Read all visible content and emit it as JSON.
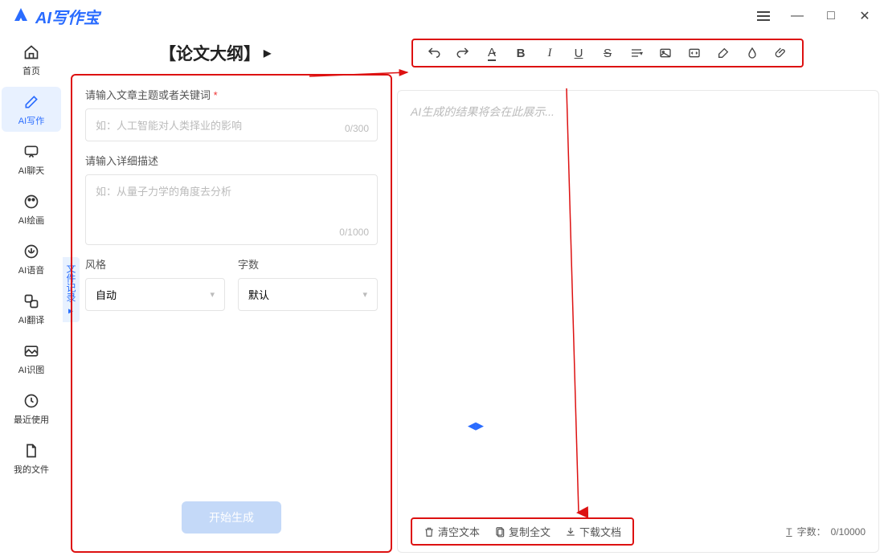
{
  "app": {
    "name": "AI写作宝"
  },
  "window": {
    "menu": "≡",
    "min": "—",
    "max": "□",
    "close": "✕"
  },
  "sidebar": {
    "items": [
      {
        "label": "首页",
        "icon": "home"
      },
      {
        "label": "AI写作",
        "icon": "edit"
      },
      {
        "label": "AI聊天",
        "icon": "chat"
      },
      {
        "label": "AI绘画",
        "icon": "paint"
      },
      {
        "label": "AI语音",
        "icon": "mic"
      },
      {
        "label": "AI翻译",
        "icon": "translate"
      },
      {
        "label": "AI识图",
        "icon": "image"
      },
      {
        "label": "最近使用",
        "icon": "clock"
      },
      {
        "label": "我的文件",
        "icon": "file"
      }
    ],
    "side_tab": "文件记录"
  },
  "page": {
    "title_l": "【论文大纲】",
    "title_arrow": "▶"
  },
  "toolbar": {
    "undo": "↶",
    "redo": "↷",
    "font": "A",
    "bold": "B",
    "italic": "I",
    "underline": "U",
    "strike": "S",
    "align": "≡",
    "image": "▢",
    "code": "▣",
    "brush": "✎",
    "drop": "◯",
    "attach": "📎"
  },
  "form": {
    "topic_label": "请输入文章主题或者关键词",
    "topic_placeholder": "如：人工智能对人类择业的影响",
    "topic_counter": "0/300",
    "detail_label": "请输入详细描述",
    "detail_placeholder": "如：从量子力学的角度去分析",
    "detail_counter": "0/1000",
    "style_label": "风格",
    "style_value": "自动",
    "count_label": "字数",
    "count_value": "默认",
    "generate": "开始生成"
  },
  "editor": {
    "placeholder": "AI生成的结果将会在此展示..."
  },
  "footer": {
    "clear": "清空文本",
    "copy": "复制全文",
    "download": "下载文档",
    "wc_label": "字数：",
    "wc_value": "0/10000",
    "wc_icon": "T"
  }
}
